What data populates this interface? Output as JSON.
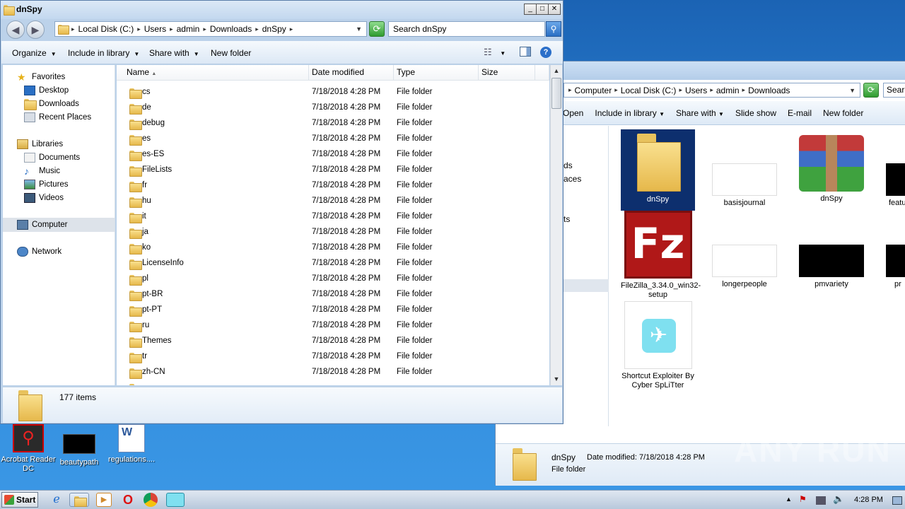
{
  "main_window": {
    "title": "dnSpy",
    "controls": {
      "minimize": "_",
      "maximize": "□",
      "close": "✕"
    },
    "address": [
      "Local Disk (C:)",
      "Users",
      "admin",
      "Downloads",
      "dnSpy"
    ],
    "search_placeholder": "Search dnSpy",
    "toolbar": {
      "organize": "Organize",
      "include_in_library": "Include in library",
      "share_with": "Share with",
      "new_folder": "New folder"
    },
    "nav": {
      "favorites": "Favorites",
      "desktop": "Desktop",
      "downloads": "Downloads",
      "recent_places": "Recent Places",
      "libraries": "Libraries",
      "documents": "Documents",
      "music": "Music",
      "pictures": "Pictures",
      "videos": "Videos",
      "computer": "Computer",
      "network": "Network"
    },
    "columns": {
      "name": "Name",
      "date_modified": "Date modified",
      "type": "Type",
      "size": "Size"
    },
    "files": [
      {
        "name": "cs",
        "date": "7/18/2018 4:28 PM",
        "type": "File folder"
      },
      {
        "name": "de",
        "date": "7/18/2018 4:28 PM",
        "type": "File folder"
      },
      {
        "name": "debug",
        "date": "7/18/2018 4:28 PM",
        "type": "File folder"
      },
      {
        "name": "es",
        "date": "7/18/2018 4:28 PM",
        "type": "File folder"
      },
      {
        "name": "es-ES",
        "date": "7/18/2018 4:28 PM",
        "type": "File folder"
      },
      {
        "name": "FileLists",
        "date": "7/18/2018 4:28 PM",
        "type": "File folder"
      },
      {
        "name": "fr",
        "date": "7/18/2018 4:28 PM",
        "type": "File folder"
      },
      {
        "name": "hu",
        "date": "7/18/2018 4:28 PM",
        "type": "File folder"
      },
      {
        "name": "it",
        "date": "7/18/2018 4:28 PM",
        "type": "File folder"
      },
      {
        "name": "ja",
        "date": "7/18/2018 4:28 PM",
        "type": "File folder"
      },
      {
        "name": "ko",
        "date": "7/18/2018 4:28 PM",
        "type": "File folder"
      },
      {
        "name": "LicenseInfo",
        "date": "7/18/2018 4:28 PM",
        "type": "File folder"
      },
      {
        "name": "pl",
        "date": "7/18/2018 4:28 PM",
        "type": "File folder"
      },
      {
        "name": "pt-BR",
        "date": "7/18/2018 4:28 PM",
        "type": "File folder"
      },
      {
        "name": "pt-PT",
        "date": "7/18/2018 4:28 PM",
        "type": "File folder"
      },
      {
        "name": "ru",
        "date": "7/18/2018 4:28 PM",
        "type": "File folder"
      },
      {
        "name": "Themes",
        "date": "7/18/2018 4:28 PM",
        "type": "File folder"
      },
      {
        "name": "tr",
        "date": "7/18/2018 4:28 PM",
        "type": "File folder"
      },
      {
        "name": "zh-CN",
        "date": "7/18/2018 4:28 PM",
        "type": "File folder"
      }
    ],
    "status": "177 items"
  },
  "bg_window": {
    "address": [
      "Computer",
      "Local Disk (C:)",
      "Users",
      "admin",
      "Downloads"
    ],
    "search_placeholder": "Searc",
    "toolbar": {
      "open": "Open",
      "include_in_library": "Include in library",
      "share_with": "Share with",
      "slide_show": "Slide show",
      "email": "E-mail",
      "new_folder": "New folder"
    },
    "nav_fragments": [
      "ds",
      "aces",
      "ts"
    ],
    "tiles": {
      "dnspy_folder": "dnSpy",
      "basisjournal": "basisjournal",
      "dnspy_exe": "dnSpy",
      "featu": "featu",
      "filezilla": "FileZilla_3.34.0_win32-setup",
      "longerpeople": "longerpeople",
      "pmvariety": "pmvariety",
      "pr": "pr",
      "shortcut_exploiter": "Shortcut Exploiter By Cyber SpLiTter"
    },
    "details": {
      "name": "dnSpy",
      "date_label": "Date modified:",
      "date": "7/18/2018 4:28 PM",
      "type": "File folder"
    }
  },
  "desktop": {
    "acrobat": "Acrobat Reader DC",
    "beautypath": "beautypath",
    "regulations": "regulations...."
  },
  "watermark": "ANY RUN",
  "taskbar": {
    "start": "Start",
    "clock": "4:28 PM",
    "tray_up": "▲"
  },
  "colors": {
    "desktop": "#2d85d6",
    "window_frame": "#bcd2ea",
    "selection": "#0d2f6e"
  }
}
